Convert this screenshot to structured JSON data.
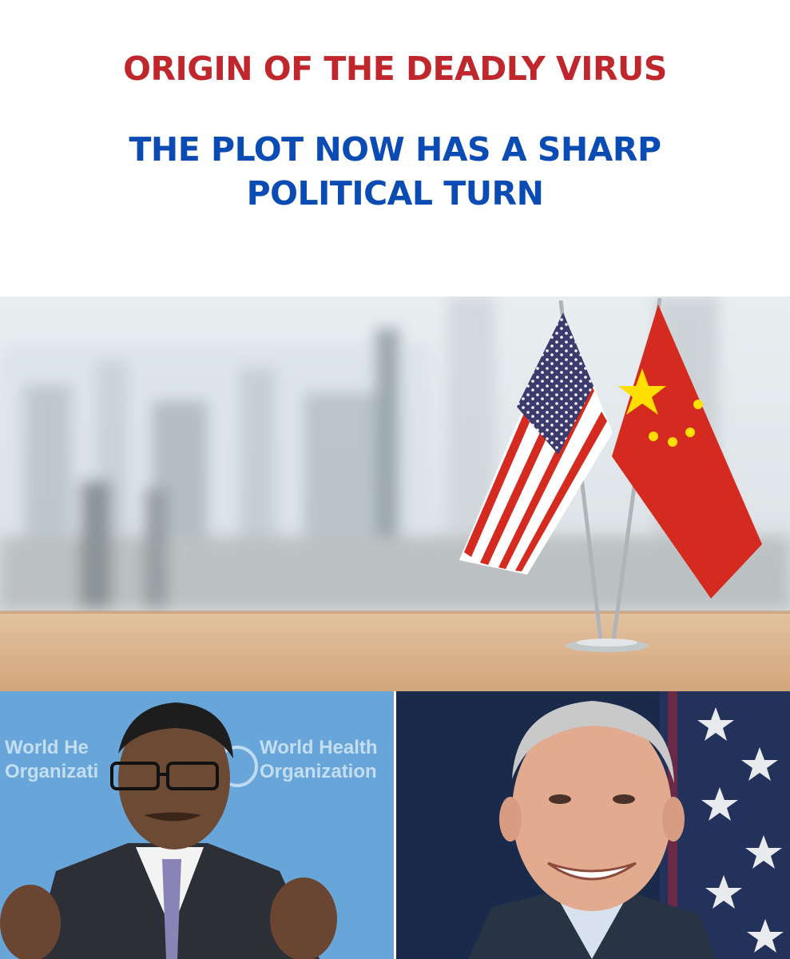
{
  "headline": {
    "line1": "ORIGIN OF THE DEADLY VIRUS",
    "line2a": "THE PLOT NOW HAS A SHARP",
    "line2b": "POLITICAL TURN"
  },
  "colors": {
    "headline_red": "#c0272d",
    "headline_blue": "#0a4bb4",
    "flag_red": "#d52a1f",
    "flag_blue": "#3c3b6e",
    "star_yellow": "#ffde00",
    "wood": "#d9b48d"
  },
  "photos": {
    "flags": "us-and-china-desk-flags",
    "left_portrait": "who-official-speaking",
    "right_portrait": "man-smiling-before-us-flag"
  },
  "backdrop_text": {
    "who_left_1": "World He",
    "who_left_2": "Organizati",
    "who_right_1": "World Health",
    "who_right_2": "Organization"
  }
}
